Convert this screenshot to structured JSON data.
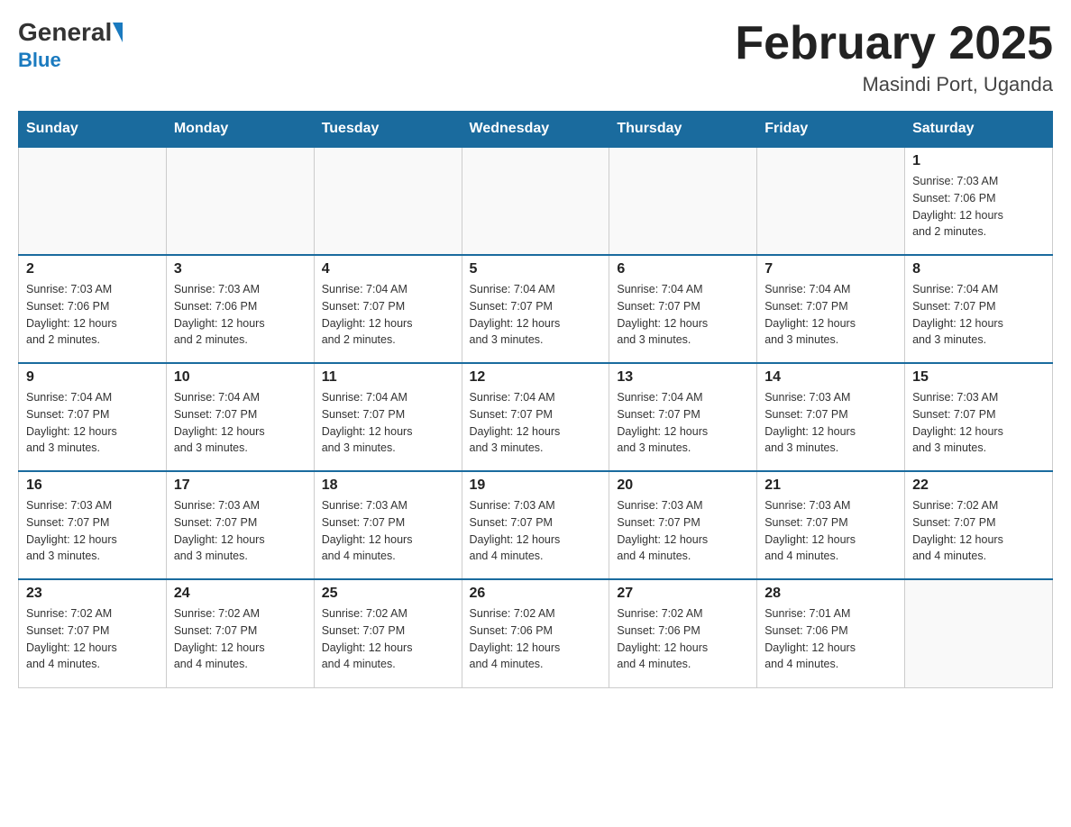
{
  "header": {
    "logo_general": "General",
    "logo_blue": "Blue",
    "month_title": "February 2025",
    "location": "Masindi Port, Uganda"
  },
  "weekdays": [
    "Sunday",
    "Monday",
    "Tuesday",
    "Wednesday",
    "Thursday",
    "Friday",
    "Saturday"
  ],
  "weeks": [
    [
      {
        "day": "",
        "info": ""
      },
      {
        "day": "",
        "info": ""
      },
      {
        "day": "",
        "info": ""
      },
      {
        "day": "",
        "info": ""
      },
      {
        "day": "",
        "info": ""
      },
      {
        "day": "",
        "info": ""
      },
      {
        "day": "1",
        "info": "Sunrise: 7:03 AM\nSunset: 7:06 PM\nDaylight: 12 hours\nand 2 minutes."
      }
    ],
    [
      {
        "day": "2",
        "info": "Sunrise: 7:03 AM\nSunset: 7:06 PM\nDaylight: 12 hours\nand 2 minutes."
      },
      {
        "day": "3",
        "info": "Sunrise: 7:03 AM\nSunset: 7:06 PM\nDaylight: 12 hours\nand 2 minutes."
      },
      {
        "day": "4",
        "info": "Sunrise: 7:04 AM\nSunset: 7:07 PM\nDaylight: 12 hours\nand 2 minutes."
      },
      {
        "day": "5",
        "info": "Sunrise: 7:04 AM\nSunset: 7:07 PM\nDaylight: 12 hours\nand 3 minutes."
      },
      {
        "day": "6",
        "info": "Sunrise: 7:04 AM\nSunset: 7:07 PM\nDaylight: 12 hours\nand 3 minutes."
      },
      {
        "day": "7",
        "info": "Sunrise: 7:04 AM\nSunset: 7:07 PM\nDaylight: 12 hours\nand 3 minutes."
      },
      {
        "day": "8",
        "info": "Sunrise: 7:04 AM\nSunset: 7:07 PM\nDaylight: 12 hours\nand 3 minutes."
      }
    ],
    [
      {
        "day": "9",
        "info": "Sunrise: 7:04 AM\nSunset: 7:07 PM\nDaylight: 12 hours\nand 3 minutes."
      },
      {
        "day": "10",
        "info": "Sunrise: 7:04 AM\nSunset: 7:07 PM\nDaylight: 12 hours\nand 3 minutes."
      },
      {
        "day": "11",
        "info": "Sunrise: 7:04 AM\nSunset: 7:07 PM\nDaylight: 12 hours\nand 3 minutes."
      },
      {
        "day": "12",
        "info": "Sunrise: 7:04 AM\nSunset: 7:07 PM\nDaylight: 12 hours\nand 3 minutes."
      },
      {
        "day": "13",
        "info": "Sunrise: 7:04 AM\nSunset: 7:07 PM\nDaylight: 12 hours\nand 3 minutes."
      },
      {
        "day": "14",
        "info": "Sunrise: 7:03 AM\nSunset: 7:07 PM\nDaylight: 12 hours\nand 3 minutes."
      },
      {
        "day": "15",
        "info": "Sunrise: 7:03 AM\nSunset: 7:07 PM\nDaylight: 12 hours\nand 3 minutes."
      }
    ],
    [
      {
        "day": "16",
        "info": "Sunrise: 7:03 AM\nSunset: 7:07 PM\nDaylight: 12 hours\nand 3 minutes."
      },
      {
        "day": "17",
        "info": "Sunrise: 7:03 AM\nSunset: 7:07 PM\nDaylight: 12 hours\nand 3 minutes."
      },
      {
        "day": "18",
        "info": "Sunrise: 7:03 AM\nSunset: 7:07 PM\nDaylight: 12 hours\nand 4 minutes."
      },
      {
        "day": "19",
        "info": "Sunrise: 7:03 AM\nSunset: 7:07 PM\nDaylight: 12 hours\nand 4 minutes."
      },
      {
        "day": "20",
        "info": "Sunrise: 7:03 AM\nSunset: 7:07 PM\nDaylight: 12 hours\nand 4 minutes."
      },
      {
        "day": "21",
        "info": "Sunrise: 7:03 AM\nSunset: 7:07 PM\nDaylight: 12 hours\nand 4 minutes."
      },
      {
        "day": "22",
        "info": "Sunrise: 7:02 AM\nSunset: 7:07 PM\nDaylight: 12 hours\nand 4 minutes."
      }
    ],
    [
      {
        "day": "23",
        "info": "Sunrise: 7:02 AM\nSunset: 7:07 PM\nDaylight: 12 hours\nand 4 minutes."
      },
      {
        "day": "24",
        "info": "Sunrise: 7:02 AM\nSunset: 7:07 PM\nDaylight: 12 hours\nand 4 minutes."
      },
      {
        "day": "25",
        "info": "Sunrise: 7:02 AM\nSunset: 7:07 PM\nDaylight: 12 hours\nand 4 minutes."
      },
      {
        "day": "26",
        "info": "Sunrise: 7:02 AM\nSunset: 7:06 PM\nDaylight: 12 hours\nand 4 minutes."
      },
      {
        "day": "27",
        "info": "Sunrise: 7:02 AM\nSunset: 7:06 PM\nDaylight: 12 hours\nand 4 minutes."
      },
      {
        "day": "28",
        "info": "Sunrise: 7:01 AM\nSunset: 7:06 PM\nDaylight: 12 hours\nand 4 minutes."
      },
      {
        "day": "",
        "info": ""
      }
    ]
  ]
}
